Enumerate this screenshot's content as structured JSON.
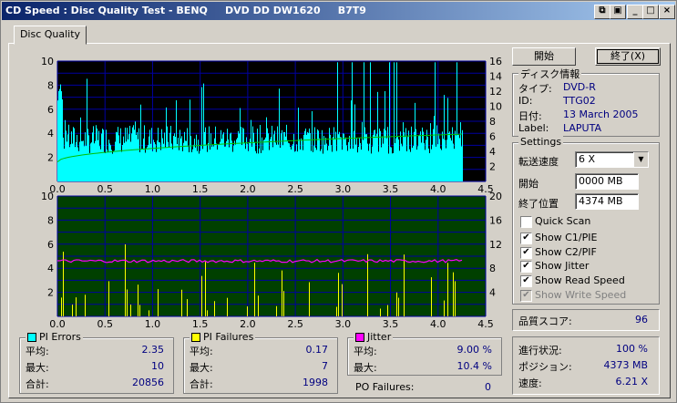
{
  "window": {
    "title": "CD Speed : Disc Quality Test - BENQ     DVD DD DW1620     B7T9"
  },
  "tab": {
    "label": "Disc Quality"
  },
  "buttons": {
    "start": "開始",
    "exit": "終了(X)"
  },
  "disc_info": {
    "title": "ディスク情報",
    "type_label": "タイプ:",
    "type_value": "DVD-R",
    "id_label": "ID:",
    "id_value": "TTG02",
    "date_label": "日付:",
    "date_value": "13 March 2005",
    "label_label": "Label:",
    "label_value": "LAPUTA"
  },
  "settings": {
    "title": "Settings",
    "speed_label": "転送速度",
    "speed_value": "6 X",
    "start_label": "開始",
    "start_value": "0000 MB",
    "end_label": "終了位置",
    "end_value": "4374 MB",
    "quick_scan": "Quick Scan",
    "show_c1": "Show C1/PIE",
    "show_c2": "Show C2/PIF",
    "show_jitter": "Show Jitter",
    "show_read": "Show Read Speed",
    "show_write": "Show Write Speed"
  },
  "quality": {
    "label": "品質スコア:",
    "value": "96"
  },
  "progress": {
    "progress_label": "進行状況:",
    "progress_value": "100 %",
    "position_label": "ポジション:",
    "position_value": "4373 MB",
    "speed_label": "速度:",
    "speed_value": "6.21 X"
  },
  "pi_errors": {
    "title": "PI Errors",
    "avg_label": "平均:",
    "avg": "2.35",
    "max_label": "最大:",
    "max": "10",
    "total_label": "合計:",
    "total": "20856"
  },
  "pi_failures": {
    "title": "PI Failures",
    "avg_label": "平均:",
    "avg": "0.17",
    "max_label": "最大:",
    "max": "7",
    "total_label": "合計:",
    "total": "1998"
  },
  "jitter": {
    "title": "Jitter",
    "avg_label": "平均:",
    "avg": "9.00 %",
    "max_label": "最大:",
    "max": "10.4 %",
    "po_label": "PO Failures:",
    "po": "0"
  },
  "colors": {
    "pie": "#00ffff",
    "pif": "#ffff00",
    "jitter": "#ff00ff",
    "speed": "#00c000",
    "plot_bg_top": "#000000",
    "plot_bg_bottom": "#004000",
    "grid": "#0000a0"
  },
  "chart_data": [
    {
      "type": "bar",
      "name": "PI Errors",
      "xlim": [
        0,
        4.5
      ],
      "xticks": [
        "0.0",
        "0.5",
        "1.0",
        "1.5",
        "2.0",
        "2.5",
        "3.0",
        "3.5",
        "4.0",
        "4.5"
      ],
      "ylim": [
        0,
        10
      ],
      "yticks_left": [
        "2",
        "4",
        "6",
        "8",
        "10"
      ],
      "ylim_right": [
        0,
        16
      ],
      "yticks_right": [
        "2",
        "4",
        "6",
        "8",
        "10",
        "12",
        "14",
        "16"
      ],
      "pie_base": 2.3,
      "data_end": 4.26,
      "read_speed_start": 2.6,
      "read_speed_end": 6.3
    },
    {
      "type": "bar",
      "name": "PI Failures",
      "xlim": [
        0,
        4.5
      ],
      "xticks": [
        "0.0",
        "0.5",
        "1.0",
        "1.5",
        "2.0",
        "2.5",
        "3.0",
        "3.5",
        "4.0",
        "4.5"
      ],
      "ylim": [
        0,
        10
      ],
      "yticks_left": [
        "2",
        "4",
        "6",
        "8",
        "10"
      ],
      "ylim_right": [
        0,
        20
      ],
      "yticks_right": [
        "4",
        "8",
        "12",
        "16",
        "20"
      ],
      "jitter_level": 4.6,
      "data_end": 4.26
    }
  ]
}
